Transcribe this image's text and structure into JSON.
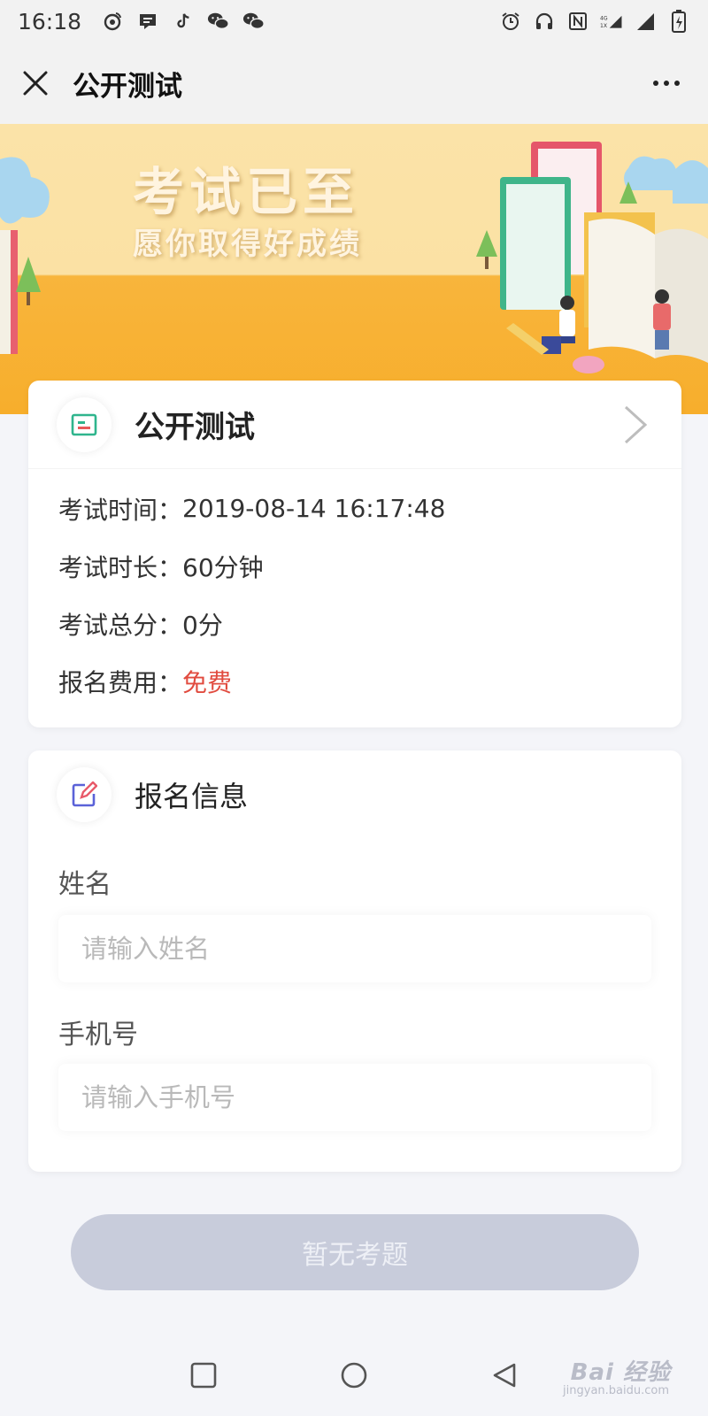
{
  "status_bar": {
    "time": "16:18",
    "left_icons": [
      "weibo-icon",
      "message-icon",
      "tiktok-icon",
      "wechat-icon",
      "wechat-icon"
    ],
    "right_icons": [
      "alarm-icon",
      "headphones-icon",
      "nfc-icon",
      "4g-signal-icon",
      "signal-icon",
      "battery-icon"
    ]
  },
  "nav": {
    "title": "公开测试",
    "close_icon": "close-icon",
    "more_icon": "more-icon"
  },
  "banner": {
    "title": "考试已至",
    "subtitle": "愿你取得好成绩"
  },
  "exam_card": {
    "title": "公开测试",
    "icon": "exam-card-icon",
    "rows": [
      {
        "label": "考试时间：",
        "value": "2019-08-14 16:17:48"
      },
      {
        "label": "考试时长：",
        "value": "60分钟"
      },
      {
        "label": "考试总分：",
        "value": "0分"
      },
      {
        "label": "报名费用：",
        "value": "免费"
      }
    ],
    "fee_color": "#e14b3f"
  },
  "signup_card": {
    "title": "报名信息",
    "icon": "edit-icon",
    "name_label": "姓名",
    "name_placeholder": "请输入姓名",
    "phone_label": "手机号",
    "phone_placeholder": "请输入手机号"
  },
  "action_button": {
    "label": "暂无考题"
  },
  "watermark": {
    "text": "Bai 经验",
    "sub": "jingyan.baidu.com"
  }
}
